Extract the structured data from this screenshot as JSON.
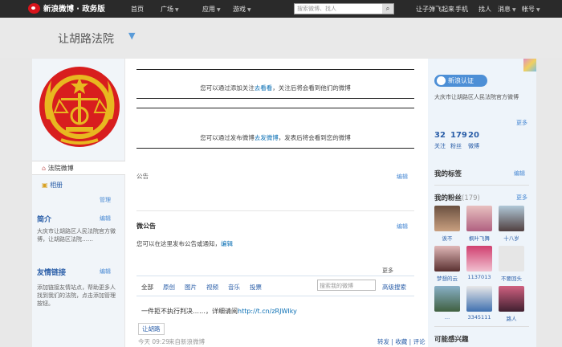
{
  "topbar": {
    "logo": "新浪微博 · 政务版",
    "nav": [
      "首页",
      "广场",
      "应用",
      "游戏"
    ],
    "search_placeholder": "搜索微博、找人",
    "right": [
      "让子弹飞起来",
      "手机",
      "找人",
      "消息",
      "帐号"
    ]
  },
  "header": {
    "title": "让胡路法院"
  },
  "left": {
    "nav": [
      {
        "label": "法院微博"
      },
      {
        "label": "相册"
      }
    ],
    "manage": "管理",
    "intro_title": "简介",
    "intro_edit": "编辑",
    "intro_text": "大庆市让胡路区人民法院官方微博，让胡路区法院……",
    "links_title": "友情链接",
    "links_edit": "编辑",
    "links_text": "添加链接友情站点，帮助更多人找到我们的法院，点击添加管理按钮。"
  },
  "main": {
    "notice1_prefix": "您可以通过添加关注",
    "notice1_link": "去看看",
    "notice1_suffix": "，关注后将会看到他们的微博",
    "notice2_prefix": "您可以通过发布微博",
    "notice2_link": "去发微博",
    "notice2_suffix": "，发表后将会看到您的微博",
    "notice_label": "公告",
    "notice_edit": "编辑",
    "bulletin_label": "微公告",
    "bulletin_edit": "编辑",
    "bulletin_text": "您可以在这里发布公告或通知，",
    "bulletin_link": "编辑",
    "tabs": [
      "全部",
      "原创",
      "图片",
      "视频",
      "音乐",
      "投票"
    ],
    "search_placeholder": "搜索我的微博",
    "search_btn": "高级搜索",
    "post_text": "一件拒不执行判决……，详细请阅",
    "post_link": "http://t.cn/zRJWIky",
    "post_tag": "让胡路",
    "post_time": "今天 09:29",
    "post_via": "来自新浪微博",
    "post_actions": "转发 | 收藏 | 评论",
    "more_label": "更多"
  },
  "right": {
    "verify": "新浪认证",
    "desc": "大庆市让胡路区人民法院官方微博",
    "more": "更多",
    "stats": [
      {
        "n": "32",
        "l": "关注"
      },
      {
        "n": "179",
        "l": "粉丝"
      },
      {
        "n": "20",
        "l": "微博"
      }
    ],
    "tags_title": "我的标签",
    "tags_edit": "编辑",
    "fans_title": "我的粉丝",
    "fans_count": "(179)",
    "fans_more": "更多",
    "fans": [
      "诶不",
      "枫叶飞舞",
      "十八岁",
      "梦想的云",
      "1137013",
      "不要回头",
      "…",
      "3345111",
      "路人"
    ],
    "related_title": "可能感兴趣"
  }
}
